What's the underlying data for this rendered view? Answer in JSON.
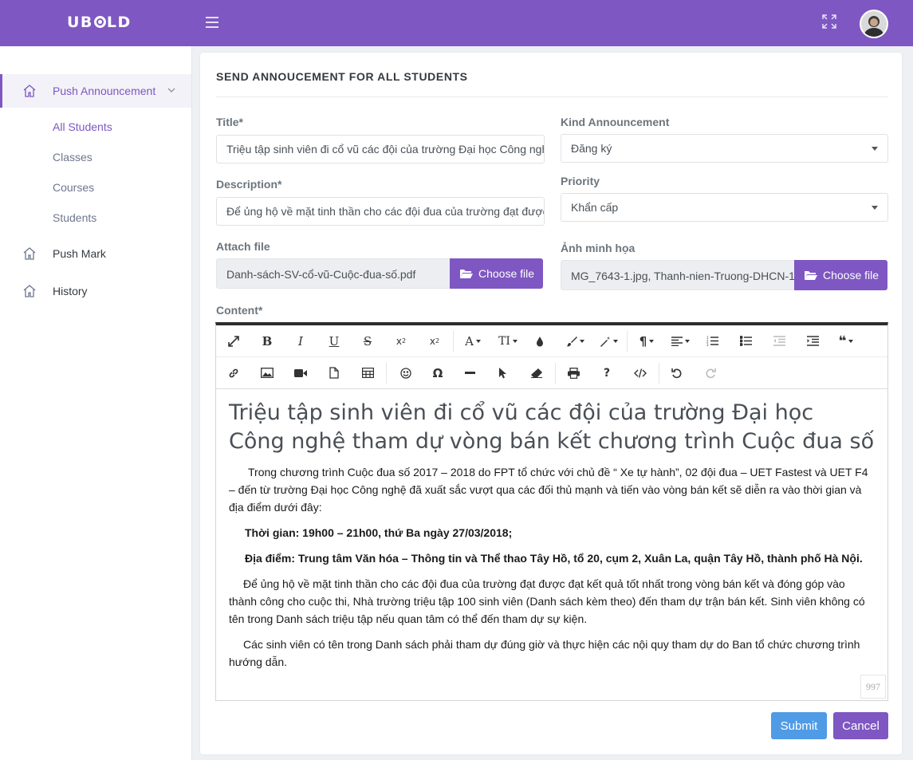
{
  "topbar": {
    "logo": "UBOLD",
    "accent": "#7e57c2"
  },
  "sidebar": {
    "push_announcement": "Push Announcement",
    "sub_items": [
      "All Students",
      "Classes",
      "Courses",
      "Students"
    ],
    "push_mark": "Push Mark",
    "history": "History"
  },
  "form": {
    "heading": "SEND ANNOUCEMENT FOR ALL STUDENTS",
    "title_label": "Title*",
    "title_value": "Triệu tập sinh viên đi cổ vũ các đội của trường Đại học Công nghệ tham dự vòng bán kết chương trình Cuộc đua số",
    "description_label": "Description*",
    "description_value": "Để ủng hộ về mặt tinh thần cho các đội đua của trường đạt được đạt kết quả tốt nhất trong vòng bán kết",
    "attach_label": "Attach file",
    "attach_value": "Danh-sách-SV-cổ-vũ-Cuộc-đua-số.pdf",
    "choose_file": "Choose file",
    "kind_label": "Kind Announcement",
    "kind_value": "Đăng ký",
    "priority_label": "Priority",
    "priority_value": "Khẩn cấp",
    "image_label": "Ảnh minh họa",
    "image_value": "MG_7643-1.jpg, Thanh-nien-Truong-DHCN-1",
    "content_label": "Content*"
  },
  "editor": {
    "toolbar_row1": [
      "expand-icon",
      "bold-icon",
      "italic-icon",
      "underline-icon",
      "strikethrough-icon",
      "subscript-icon",
      "superscript-icon",
      "font-color-icon",
      "font-size-icon",
      "drop-icon",
      "brush-icon",
      "magic-icon",
      "paragraph-icon",
      "align-icon",
      "ordered-list-icon",
      "unordered-list-icon",
      "outdent-icon",
      "indent-icon",
      "quote-icon"
    ],
    "toolbar_row2": [
      "link-icon",
      "image-icon",
      "video-icon",
      "file-icon",
      "table-icon",
      "emoji-icon",
      "omega-icon",
      "horizontal-line-icon",
      "cursor-icon",
      "eraser-icon",
      "print-icon",
      "help-icon",
      "code-icon",
      "undo-icon",
      "redo-icon"
    ],
    "heading": "Triệu tập sinh viên đi cổ vũ các đội của trường Đại học Công nghệ tham dự vòng bán kết chương trình Cuộc đua số",
    "p1": "Trong chương trình Cuộc đua số 2017 – 2018 do FPT tổ chức với chủ đề “ Xe tự hành”, 02 đội đua – UET Fastest và UET F4 – đến từ trường Đại học Công nghệ đã xuất sắc vượt qua các đối thủ mạnh và tiến vào vòng bán kết sẽ diễn ra vào thời gian và địa điểm dưới đây:",
    "p2": "Thời gian: 19h00 – 21h00, thứ Ba ngày 27/03/2018;",
    "p3": "Địa điểm: Trung tâm Văn hóa – Thông tin và Thể thao Tây Hồ, tổ 20, cụm 2, Xuân La, quận Tây Hồ, thành phố Hà Nội.",
    "p4": "Để ủng hộ về mặt tinh thần cho các đội đua của trường đạt được đạt kết quả tốt nhất trong vòng bán kết và đóng góp vào thành công cho cuộc thi, Nhà trường triệu tập 100 sinh viên (Danh sách kèm theo) đến tham dự trận bán kết. Sinh viên không có tên trong Danh sách triệu tập nếu quan tâm có thể đến tham dự sự kiện.",
    "p5": "Các sinh viên có tên trong Danh sách phải tham dự đúng giờ và thực hiện các nội quy tham dự do Ban tổ chức chương trình hướng dẫn.",
    "char_count": "997"
  },
  "actions": {
    "submit": "Submit",
    "cancel": "Cancel",
    "submit_color": "#4f9be6",
    "cancel_color": "#7e57c2"
  }
}
